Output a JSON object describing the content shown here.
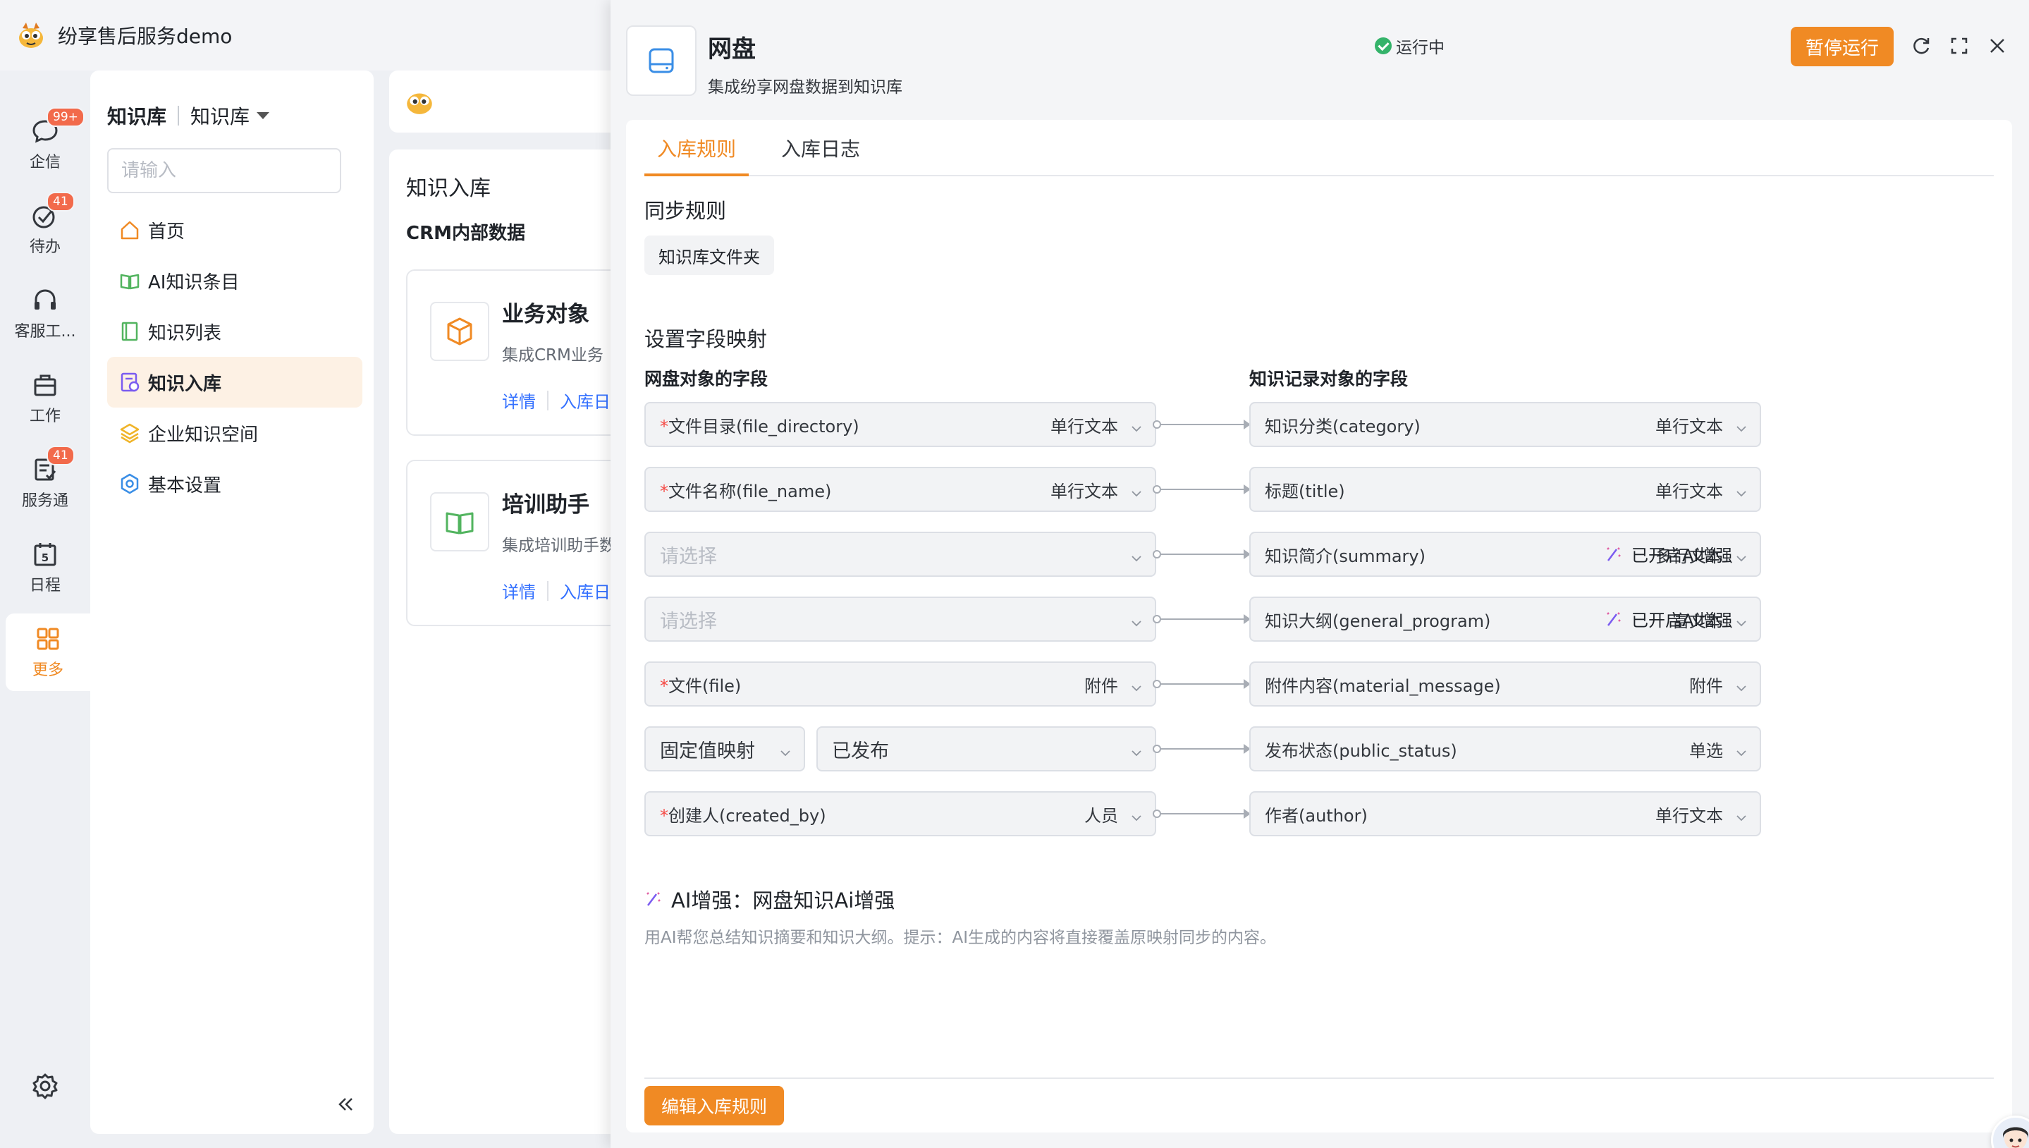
{
  "app": {
    "title": "纷享售后服务demo"
  },
  "rail": {
    "items": [
      {
        "label": "企信",
        "icon": "chat-bubble-icon",
        "badge": "99+"
      },
      {
        "label": "待办",
        "icon": "check-circle-icon",
        "badge": "41"
      },
      {
        "label": "客服工...",
        "icon": "headset-icon",
        "badge": ""
      },
      {
        "label": "工作",
        "icon": "briefcase-icon",
        "badge": ""
      },
      {
        "label": "服务通",
        "icon": "service-doc-icon",
        "badge": "41"
      },
      {
        "label": "日程",
        "icon": "calendar-icon",
        "badge": "",
        "day": "5"
      },
      {
        "label": "更多",
        "icon": "grid-icon",
        "badge": "",
        "active": true
      }
    ],
    "settings_icon": "gear-icon"
  },
  "kb": {
    "title": "知识库",
    "switcher": "知识库",
    "search_placeholder": "请输入",
    "nav": [
      {
        "label": "首页",
        "icon": "home-icon"
      },
      {
        "label": "AI知识条目",
        "icon": "book-icon"
      },
      {
        "label": "知识列表",
        "icon": "list-book-icon"
      },
      {
        "label": "知识入库",
        "icon": "import-icon",
        "active": true
      },
      {
        "label": "企业知识空间",
        "icon": "layers-icon"
      },
      {
        "label": "基本设置",
        "icon": "settings-icon"
      }
    ]
  },
  "middle": {
    "title": "知识入库",
    "subtitle": "CRM内部数据",
    "cards": [
      {
        "title": "业务对象",
        "desc": "集成CRM业务",
        "link_detail": "详情",
        "link_log": "入库日"
      },
      {
        "title": "培训助手",
        "desc": "集成培训助手数",
        "link_detail": "详情",
        "link_log": "入库日"
      }
    ]
  },
  "drawer": {
    "title": "网盘",
    "status": "运行中",
    "description": "集成纷享网盘数据到知识库",
    "pause_button": "暂停运行",
    "tabs": [
      {
        "label": "入库规则",
        "active": true
      },
      {
        "label": "入库日志"
      }
    ],
    "sync_rule_title": "同步规则",
    "sync_rule_chip": "知识库文件夹",
    "mapping_title": "设置字段映射",
    "left_header": "网盘对象的字段",
    "right_header": "知识记录对象的字段",
    "mappings": [
      {
        "src_req": "*",
        "src_label": "文件目录(file_directory)",
        "src_type": "单行文本",
        "dst_label": "知识分类(category)",
        "dst_type": "单行文本",
        "ai": ""
      },
      {
        "src_req": "*",
        "src_label": "文件名称(file_name)",
        "src_type": "单行文本",
        "dst_label": "标题(title)",
        "dst_type": "单行文本",
        "ai": ""
      },
      {
        "src_req": "",
        "src_label": "请选择",
        "src_type": "",
        "src_placeholder": true,
        "dst_label": "知识简介(summary)",
        "dst_type": "多行文本",
        "ai": "已开启AI增强"
      },
      {
        "src_req": "",
        "src_label": "请选择",
        "src_type": "",
        "src_placeholder": true,
        "dst_label": "知识大纲(general_program)",
        "dst_type": "富文本",
        "ai": "已开启AI增强"
      },
      {
        "src_req": "*",
        "src_label": "文件(file)",
        "src_type": "附件",
        "dst_label": "附件内容(material_message)",
        "dst_type": "附件",
        "ai": ""
      },
      {
        "src_mode": "固定值映射",
        "src_label": "已发布",
        "src_type": "",
        "dst_label": "发布状态(public_status)",
        "dst_type": "单选",
        "ai": ""
      },
      {
        "src_req": "*",
        "src_label": "创建人(created_by)",
        "src_type": "人员",
        "dst_label": "作者(author)",
        "dst_type": "单行文本",
        "ai": ""
      }
    ],
    "ai_section_title": "AI增强：网盘知识Ai增强",
    "ai_section_desc": "用AI帮您总结知识摘要和知识大纲。提示：AI生成的内容将直接覆盖原映射同步的内容。",
    "edit_button": "编辑入库规则"
  },
  "colors": {
    "accent": "#f08a24",
    "link": "#3370ff",
    "badge": "#f26a4b",
    "success": "#34b36a"
  }
}
